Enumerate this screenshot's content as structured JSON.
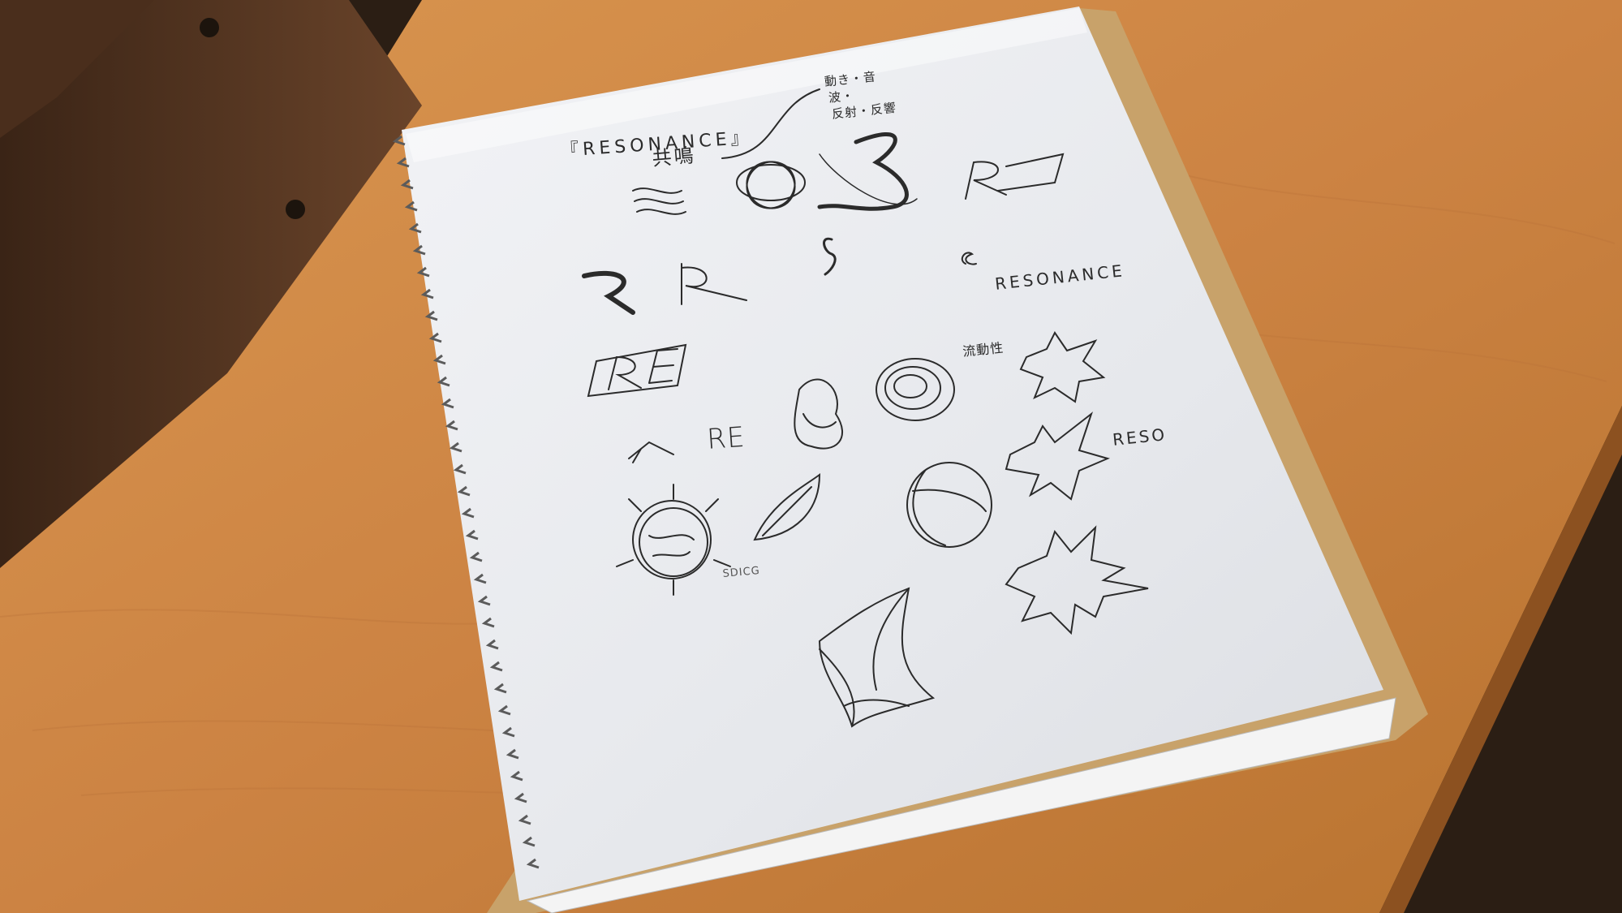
{
  "scene": {
    "description_tag": "Spiral notebook with pencil logo sketches on a wooden desk",
    "colors": {
      "desk": "#d08a48",
      "desk_dark": "#a9622c",
      "paper": "#e9eaee",
      "pencil": "#2b2b2b",
      "cardboard": "#c9a46a",
      "chair": "#5a3a24"
    }
  },
  "sketch_text": {
    "title": "『RESONANCE』",
    "title_kanji": "共鳴",
    "note_line_1": "動き・音",
    "note_line_2": "波・",
    "note_line_3": "反射・反響",
    "resonance_partial": "RESONANCE",
    "fluidity": "流動性",
    "reso": "RESO",
    "re": "RE",
    "sdicg": "SDICG"
  },
  "icons": [
    "spiral-binding-icon",
    "wave-lines-icon",
    "ring-cluster-icon",
    "swoosh-icon",
    "r-letter-icon",
    "starburst-icon",
    "globe-icon",
    "leaf-icon",
    "triangle-shard-icon"
  ]
}
